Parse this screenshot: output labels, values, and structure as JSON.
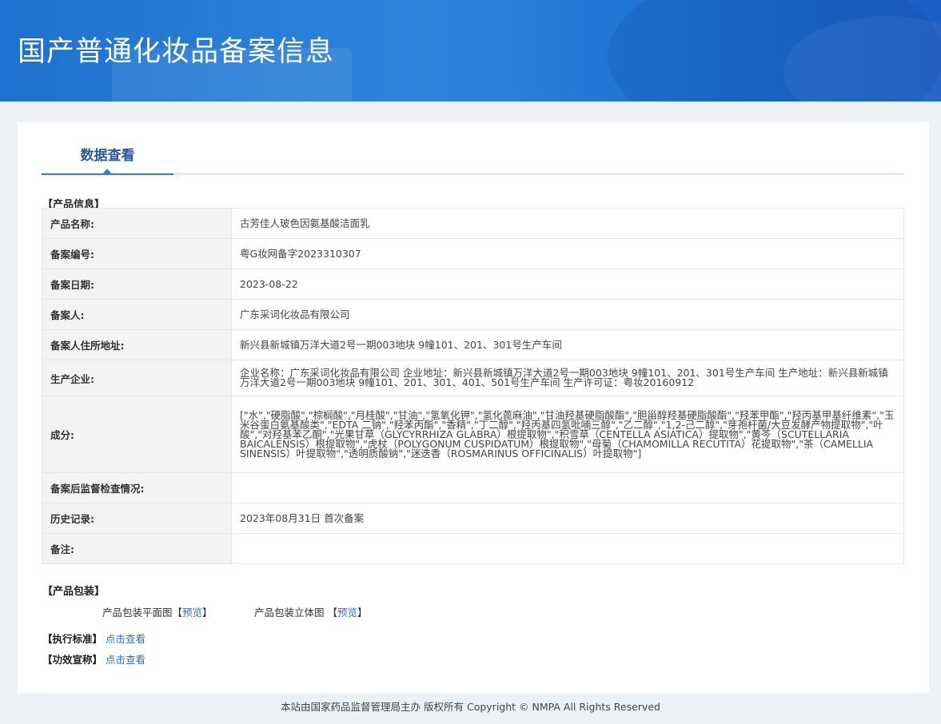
{
  "header": {
    "title": "国产普通化妆品备案信息"
  },
  "tabs": [
    {
      "label": "数据查看"
    }
  ],
  "product_info": {
    "section_title": "【产品信息】",
    "rows": [
      {
        "key": "产品名称:",
        "value": "古芳佳人玻色因氨基酸洁面乳"
      },
      {
        "key": "备案编号:",
        "value": "粤G妆网备字2023310307"
      },
      {
        "key": "备案日期:",
        "value": "2023-08-22"
      },
      {
        "key": "备案人:",
        "value": "广东采词化妆品有限公司"
      },
      {
        "key": "备案人住所地址:",
        "value": "新兴县新城镇万洋大道2号一期003地块 9幢101、201、301号生产车间"
      },
      {
        "key": "生产企业:",
        "value": "企业名称：广东采词化妆品有限公司 企业地址：新兴县新城镇万洋大道2号一期003地块 9幢101、201、301号生产车间 生产地址：新兴县新城镇万洋大道2号一期003地块 9幢101、201、301、401、501号生产车间 生产许可证：粤妆20160912"
      },
      {
        "key": "成分:",
        "value": "[\"水\",\"硬脂酸\",\"棕榈酸\",\"月桂酸\",\"甘油\",\"氢氧化钾\",\"氢化蓖麻油\",\"甘油羟基硬脂酸酯\",\"胆甾醇羟基硬脂酸酯\",\"羟苯甲酯\",\"羟丙基甲基纤维素\",\"玉米谷蛋白氨基酸类\",\"EDTA 二钠\",\"羟苯丙酯\",\"香精\",\"丁二醇\",\"羟丙基四氢吡喃三醇\",\"乙二醇\",\"1,2-己二醇\",\"芽孢杆菌/大豆发酵产物提取物\",\"叶酸\",\"对羟基苯乙酮\",\"光果甘草（GLYCYRRHIZA GLABRA）根提取物\",\"积雪草（CENTELLA ASIATICA）提取物\",\"黄芩（SCUTELLARIA BAICALENSIS）根提取物\",\"虎杖（POLYGONUM CUSPIDATUM）根提取物\",\"母菊（CHAMOMILLA RECUTITA）花提取物\",\"茶（CAMELLIA SINENSIS）叶提取物\",\"透明质酸钠\",\"迷迭香（ROSMARINUS OFFICINALIS）叶提取物\"]"
      },
      {
        "key": "备案后监督检查情况:",
        "value": ""
      },
      {
        "key": "历史记录:",
        "value": "2023年08月31日 首次备案"
      },
      {
        "key": "备注:",
        "value": ""
      }
    ]
  },
  "packaging": {
    "section_title": "【产品包装】",
    "flat_label": "产品包装平面图",
    "solid_label": "产品包装立体图",
    "bracket_open": "【",
    "bracket_close": "】",
    "preview_label": "预览"
  },
  "standard": {
    "label": "【执行标准】",
    "link": "点击查看"
  },
  "efficacy": {
    "label": "【功效宣称】",
    "link": "点击查看"
  },
  "footer": {
    "text": "本站由国家药品监督管理局主办 版权所有 Copyright © NMPA All Rights Reserved"
  }
}
